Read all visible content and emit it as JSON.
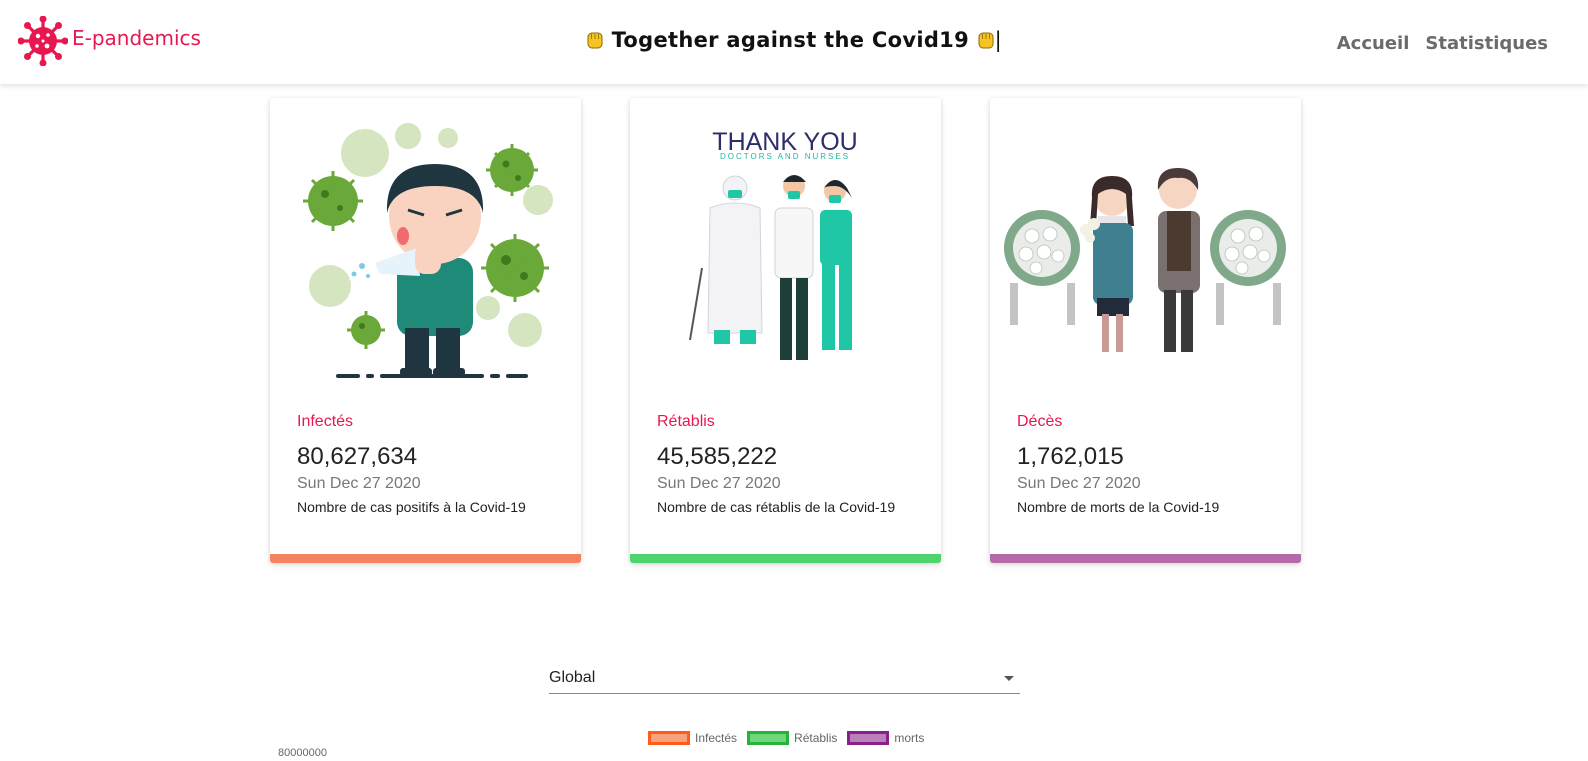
{
  "navbar": {
    "brand": "E-pandemics",
    "headline": "Together against the Covid19",
    "cursor": "|",
    "links": [
      "Accueil",
      "Statistiques"
    ]
  },
  "cards": [
    {
      "label": "Infectés",
      "value": "80,627,634",
      "date": "Sun Dec 27 2020",
      "description": "Nombre de cas positifs à la Covid-19",
      "bar_color": "#f4845f",
      "art": "sneezing-person-illustration"
    },
    {
      "label": "Rétablis",
      "value": "45,585,222",
      "date": "Sun Dec 27 2020",
      "description": "Nombre de cas rétablis de la Covid-19",
      "bar_color": "#4fd36d",
      "art_caption_1": "THANK YOU",
      "art_caption_2": "DOCTORS AND NURSES",
      "art": "medical-staff-illustration"
    },
    {
      "label": "Décès",
      "value": "1,762,015",
      "date": "Sun Dec 27 2020",
      "description": "Nombre de morts de la Covid-19",
      "bar_color": "#b46aa8",
      "art": "mourning-couple-illustration"
    }
  ],
  "selector": {
    "value": "Global"
  },
  "legend": [
    {
      "label": "Infectés",
      "fill": "#f7a27e",
      "border": "#ff5c1a"
    },
    {
      "label": "Rétablis",
      "fill": "#6fd67c",
      "border": "#25b33a"
    },
    {
      "label": "morts",
      "fill": "#b980b9",
      "border": "#8b1f8b"
    }
  ],
  "chart_partial": {
    "top_tick": "80000000"
  },
  "colors": {
    "brand": "#e8174f",
    "accent_label": "#e8174f"
  }
}
